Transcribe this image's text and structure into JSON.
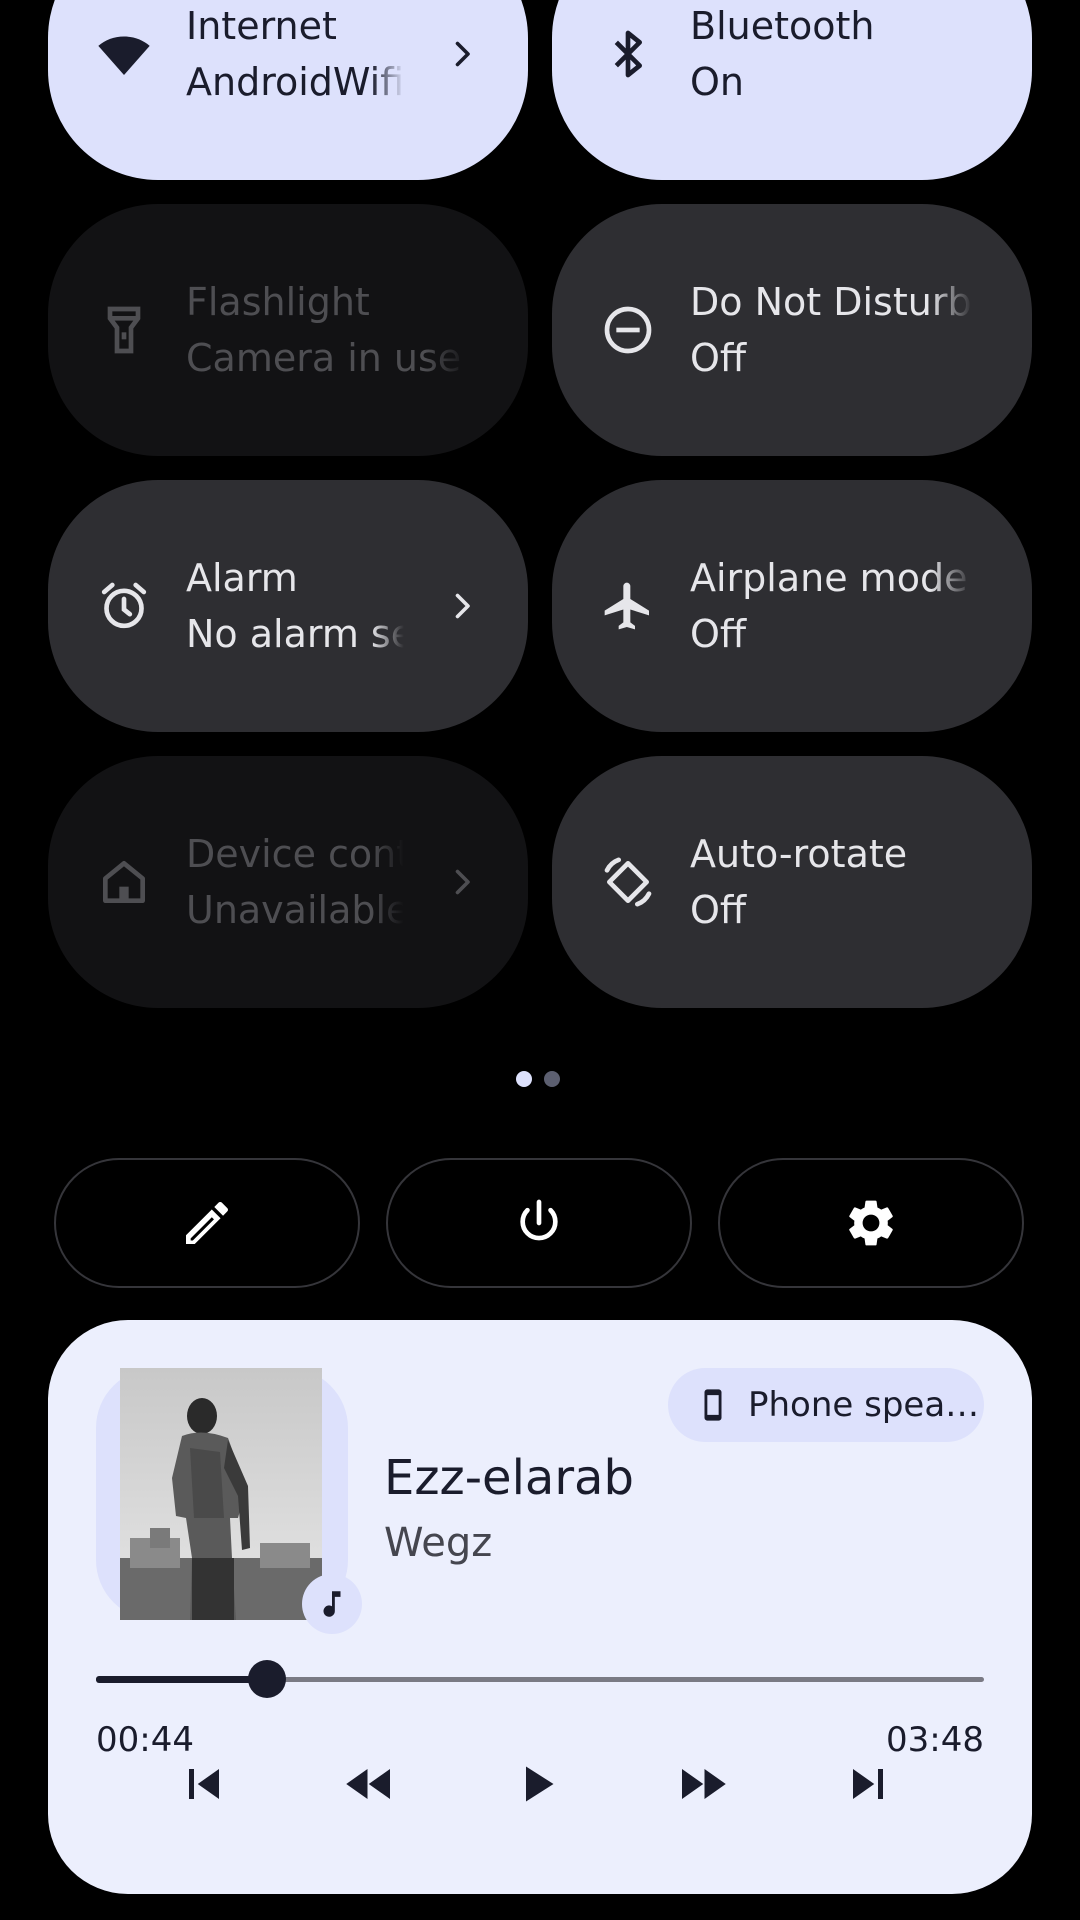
{
  "colors": {
    "tile_active": "#dde1fc",
    "tile_inactive": "#2e2e32",
    "tile_unavailable": "#121214",
    "media_bg": "#eceffd",
    "page_indicator_active": "#dde1fc",
    "page_indicator_inactive": "#5c5f70"
  },
  "tiles": [
    {
      "title": "Internet",
      "subtitle": "AndroidWifi",
      "icon": "wifi-icon",
      "state": "on",
      "chevron": true
    },
    {
      "title": "Bluetooth",
      "subtitle": "On",
      "icon": "bluetooth-icon",
      "state": "on",
      "chevron": false
    },
    {
      "title": "Flashlight",
      "subtitle": "Camera in use",
      "icon": "flashlight-icon",
      "state": "unavailable",
      "chevron": false
    },
    {
      "title": "Do Not Disturb",
      "subtitle": "Off",
      "icon": "do-not-disturb-icon",
      "state": "off",
      "chevron": false
    },
    {
      "title": "Alarm",
      "subtitle": "No alarm set",
      "icon": "alarm-icon",
      "state": "off",
      "chevron": true
    },
    {
      "title": "Airplane mode",
      "subtitle": "Off",
      "icon": "airplane-icon",
      "state": "off",
      "chevron": false
    },
    {
      "title": "Device controls",
      "subtitle": "Unavailable",
      "icon": "home-icon",
      "state": "unavailable",
      "chevron": true
    },
    {
      "title": "Auto-rotate",
      "subtitle": "Off",
      "icon": "auto-rotate-icon",
      "state": "off",
      "chevron": false
    }
  ],
  "page_indicator": {
    "pages": 2,
    "current": 1
  },
  "footer_buttons": [
    {
      "icon": "edit-icon"
    },
    {
      "icon": "power-icon"
    },
    {
      "icon": "settings-gear-icon"
    }
  ],
  "media": {
    "song": "Ezz-elarab",
    "artist": "Wegz",
    "output_device": "Phone spea…",
    "elapsed": "00:44",
    "total": "03:48",
    "progress": 0.193,
    "app_icon": "music-note-icon",
    "controls": [
      "skip-previous-icon",
      "rewind-icon",
      "play-icon",
      "fast-forward-icon",
      "skip-next-icon"
    ]
  }
}
